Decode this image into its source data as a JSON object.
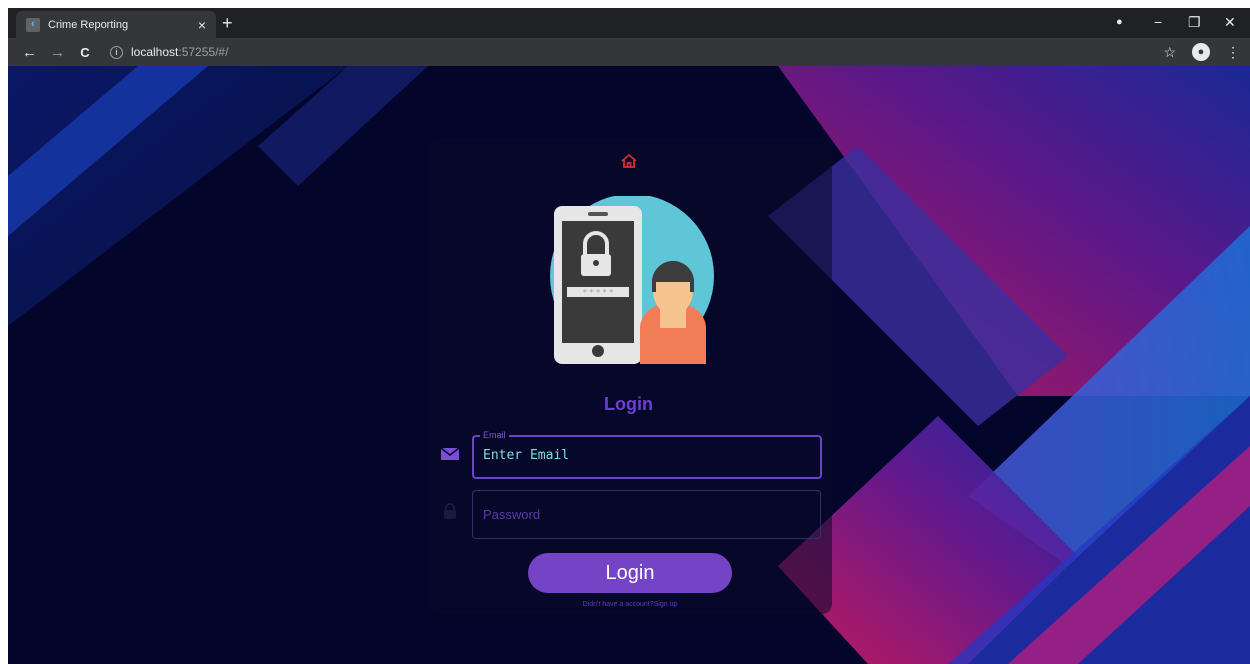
{
  "browser": {
    "tab_title": "Crime Reporting",
    "tab_close": "×",
    "new_tab": "+",
    "url_host": "localhost",
    "url_rest": ":57255/#/",
    "back": "←",
    "forward": "→",
    "reload": "C",
    "info": "i",
    "star": "☆",
    "menu": "⋮",
    "min": "−",
    "restore": "❐",
    "close": "✕",
    "tabsearch": "●"
  },
  "page": {
    "heading": "Login",
    "email_label": "Email",
    "email_value": "Enter Email",
    "password_placeholder": "Password",
    "login_button": "Login",
    "signup_text": "Didn't have a account?Sign up"
  },
  "colors": {
    "accent": "#7544c6",
    "heading": "#6d3fd0",
    "email_text": "#7de0df",
    "home_icon": "#d32f2f"
  },
  "icons": [
    "home-icon",
    "mail-icon",
    "lock-icon",
    "phone-lock-illustration"
  ]
}
